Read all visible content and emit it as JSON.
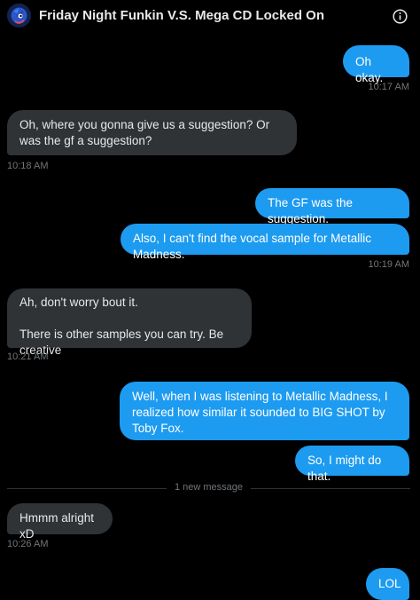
{
  "header": {
    "title": "Friday Night Funkin V.S. Mega CD Locked On",
    "avatar_icon": "conversation-avatar",
    "info_icon": "info-icon"
  },
  "messages": [
    {
      "side": "sent",
      "text": "Oh okay.",
      "time": "10:17 AM"
    },
    {
      "side": "received",
      "text": "Oh, where you gonna give us a suggestion? Or was the gf a suggestion?",
      "time": "10:18 AM"
    },
    {
      "side": "sent",
      "text": "The GF was the suggestion."
    },
    {
      "side": "sent",
      "text": "Also, I can't find the vocal sample for Metallic Madness.",
      "time": "10:19 AM"
    },
    {
      "side": "received",
      "text": "Ah, don't worry bout it.",
      "text2": "There is other samples you can try. Be creative",
      "time": "10:21 AM"
    },
    {
      "side": "sent",
      "text": "Well, when I was listening to Metallic Madness, I realized how similar it sounded to BIG SHOT by Toby Fox."
    },
    {
      "side": "sent",
      "text": "So, I might do that."
    },
    {
      "side": "received",
      "text": "Hmmm alright xD",
      "time": "10:26 AM"
    },
    {
      "side": "sent",
      "text": "LOL"
    }
  ],
  "divider": {
    "label": "1 new message"
  },
  "colors": {
    "sent_bubble": "#1d9bf0",
    "received_bubble": "#2f3336",
    "background": "#000000",
    "timestamp": "#71767b"
  }
}
